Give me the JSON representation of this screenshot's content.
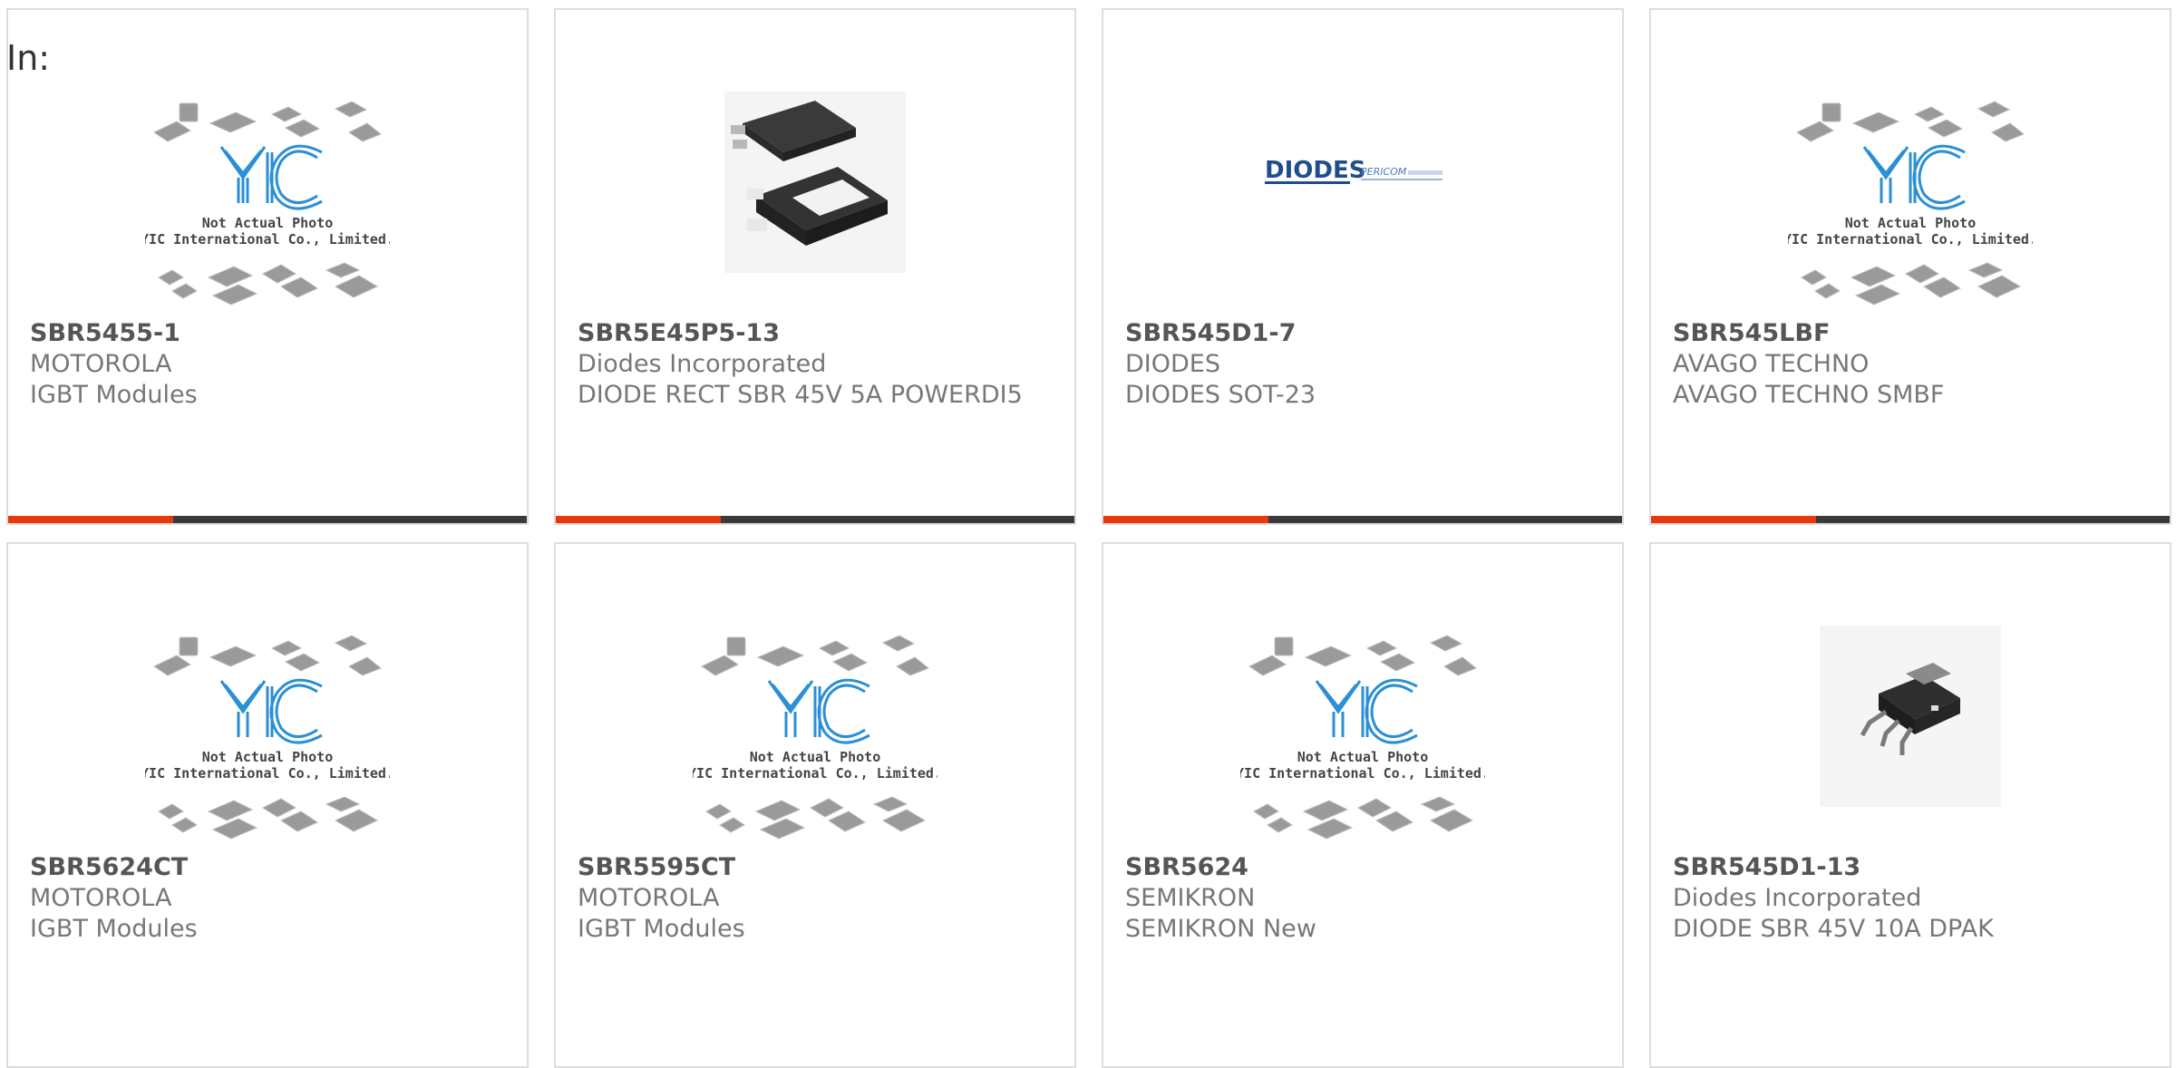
{
  "filter_label": "In:",
  "placeholder": {
    "logo_text": "YIC",
    "line1": "Not Actual Photo",
    "line2": "YIC International Co., Limited."
  },
  "colors": {
    "accent": "#e8380d",
    "bar": "#3a3a3a",
    "logo": "#2b8fd6",
    "border": "#dddddd"
  },
  "products": [
    {
      "part": "SBR5455-1",
      "manufacturer": "MOTOROLA",
      "description": "IGBT Modules",
      "image": "placeholder-image"
    },
    {
      "part": "SBR5E45P5-13",
      "manufacturer": "Diodes Incorporated",
      "description": "DIODE RECT SBR 45V 5A POWERDI5",
      "image": "powerdi5-package-photo"
    },
    {
      "part": "SBR545D1-7",
      "manufacturer": "DIODES",
      "description": "DIODES SOT-23",
      "image": "diodes-logo"
    },
    {
      "part": "SBR545LBF",
      "manufacturer": "AVAGO TECHNO",
      "description": "AVAGO TECHNO SMBF",
      "image": "placeholder-image"
    },
    {
      "part": "SBR5624CT",
      "manufacturer": "MOTOROLA",
      "description": "IGBT Modules",
      "image": "placeholder-image"
    },
    {
      "part": "SBR5595CT",
      "manufacturer": "MOTOROLA",
      "description": "IGBT Modules",
      "image": "placeholder-image"
    },
    {
      "part": "SBR5624",
      "manufacturer": "SEMIKRON",
      "description": "SEMIKRON New",
      "image": "placeholder-image"
    },
    {
      "part": "SBR545D1-13",
      "manufacturer": "Diodes Incorporated",
      "description": "DIODE SBR 45V 10A DPAK",
      "image": "dpak-package-photo"
    }
  ],
  "diodes_logo": {
    "brand": "DIODES",
    "partner": "PERICOM"
  }
}
